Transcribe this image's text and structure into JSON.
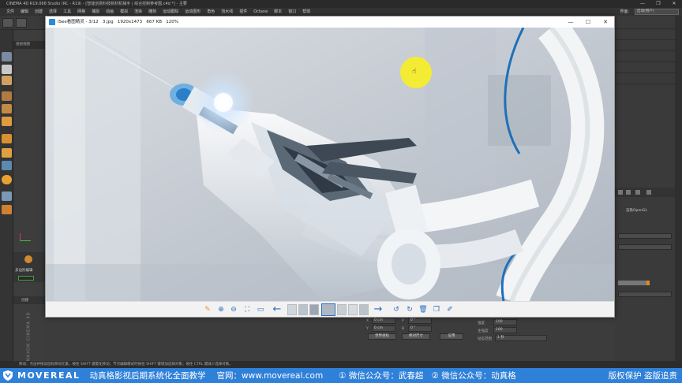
{
  "app": {
    "title": "CINEMA 4D R19.068 Studio (RC - R19) - [智能创意科技新材机械手 | 综合控制参考图.c4d *] - 主要",
    "menu": [
      "文件",
      "编辑",
      "创建",
      "选择",
      "工具",
      "网格",
      "捕捉",
      "动画",
      "模拟",
      "渲染",
      "雕刻",
      "运动跟踪",
      "运动图形",
      "角色",
      "流水线",
      "插件",
      "Octane",
      "脚本",
      "窗口",
      "帮助"
    ],
    "layout_label": "界面:",
    "layout_value": "启动(用户)",
    "window_controls": [
      "—",
      "❐",
      "✕"
    ]
  },
  "left_panel": {
    "viewport_label": "透视视图",
    "material_tab": "多边形编辑",
    "lower_tab_1": "创建",
    "lower_tab_2": "编辑",
    "axis_label": "MAXON CINEMA 4D"
  },
  "viewer": {
    "app_name": "iSee看图精灵",
    "page": "3/12",
    "filename": "3.jpg",
    "resolution": "1920x1473",
    "filesize": "667 KB",
    "zoom": "120%",
    "window_controls": [
      "—",
      "☐",
      "✕"
    ]
  },
  "right_panel": {
    "renderer_label": "渲染OpenGL",
    "radius_label": "强度",
    "radius_value": "100",
    "power_label": "主强度",
    "power_value": "100",
    "dyn_label": "动态范围",
    "dyn_value": "1 秒"
  },
  "bottom_panel": {
    "x_label": "X",
    "x_value": "0 cm",
    "y_label": "Y",
    "y_value": "0 cm",
    "z_label": "Z",
    "z_value": "0 cm",
    "h_label": "H",
    "h_value": "0 °",
    "p_label": "P",
    "p_value": "0 °",
    "b_label": "B",
    "b_value": "0 °",
    "mode_1": "世界坐标",
    "mode_2": "绝对尺寸",
    "apply": "应用"
  },
  "status_bar": "移动：点击并拖动鼠标移动元素，按住 SHIFT 键量化移动；节点编辑模式时按住 SHIFT 键增加选择对象；按住 CTRL 键减少选择对象。",
  "brand": {
    "logo": "MOVEREAL",
    "slogan": "动真格影视后期系统化全面教学",
    "site": "官网：www.movereal.com",
    "wechat1": "① 微信公众号：武春超",
    "wechat2": "② 微信公众号：动真格",
    "rights": "版权保护 盗版追责"
  },
  "colors": {
    "brand_blue": "#2f80d8",
    "c4d_bg": "#3b3b3b",
    "cursor_yellow": "#f7ee28"
  }
}
